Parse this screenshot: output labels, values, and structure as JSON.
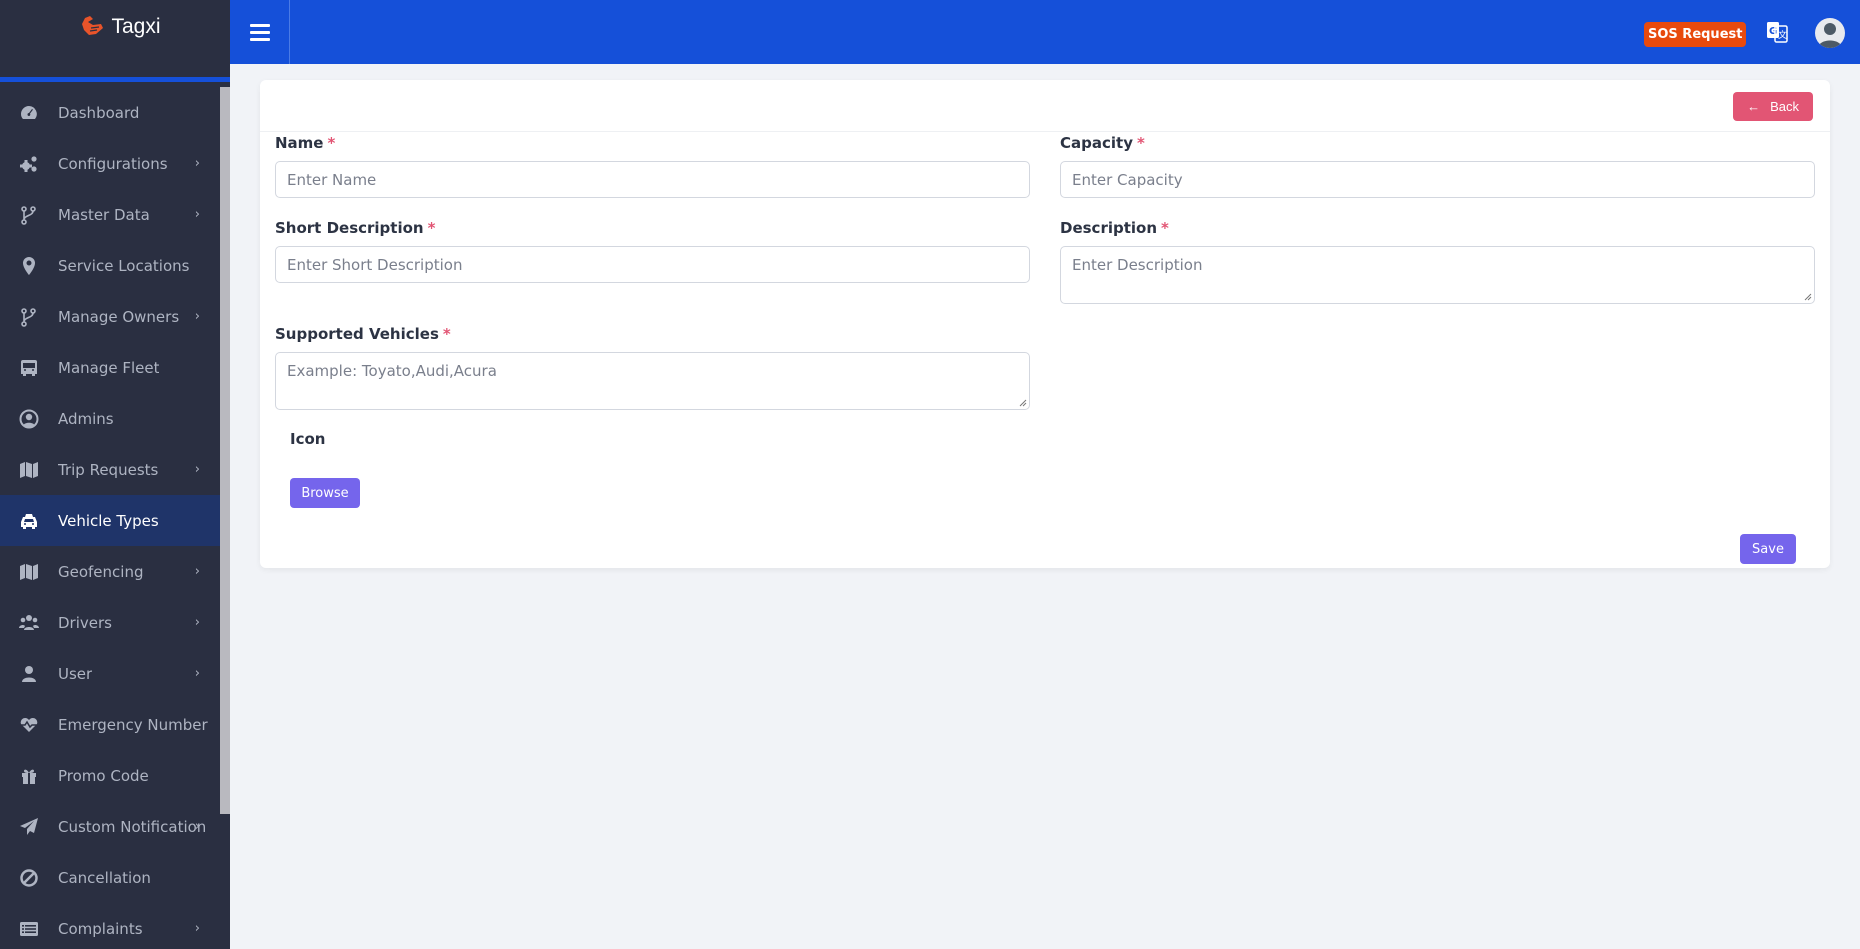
{
  "brand": {
    "name": "Tagxi",
    "logo_color": "#e8542a"
  },
  "header": {
    "sos_label": "SOS Request",
    "translate_icon": "translate-icon",
    "avatar_icon": "user-avatar-icon"
  },
  "sidebar": {
    "items": [
      {
        "label": "Dashboard",
        "icon": "dashboard-icon",
        "has_children": false,
        "active": false
      },
      {
        "label": "Configurations",
        "icon": "cogs-icon",
        "has_children": true,
        "active": false
      },
      {
        "label": "Master Data",
        "icon": "code-branch-icon",
        "has_children": true,
        "active": false
      },
      {
        "label": "Service Locations",
        "icon": "map-marker-icon",
        "has_children": false,
        "active": false
      },
      {
        "label": "Manage Owners",
        "icon": "code-branch-icon",
        "has_children": true,
        "active": false
      },
      {
        "label": "Manage Fleet",
        "icon": "bus-icon",
        "has_children": false,
        "active": false
      },
      {
        "label": "Admins",
        "icon": "user-circle-icon",
        "has_children": false,
        "active": false
      },
      {
        "label": "Trip Requests",
        "icon": "map-icon",
        "has_children": true,
        "active": false
      },
      {
        "label": "Vehicle Types",
        "icon": "taxi-icon",
        "has_children": false,
        "active": true
      },
      {
        "label": "Geofencing",
        "icon": "map-icon",
        "has_children": true,
        "active": false
      },
      {
        "label": "Drivers",
        "icon": "users-icon",
        "has_children": true,
        "active": false
      },
      {
        "label": "User",
        "icon": "user-icon",
        "has_children": true,
        "active": false
      },
      {
        "label": "Emergency Number",
        "icon": "heartbeat-icon",
        "has_children": false,
        "active": false
      },
      {
        "label": "Promo Code",
        "icon": "gift-icon",
        "has_children": false,
        "active": false
      },
      {
        "label": "Custom Notification",
        "icon": "paper-plane-icon",
        "has_children": true,
        "active": false
      },
      {
        "label": "Cancellation",
        "icon": "ban-icon",
        "has_children": false,
        "active": false
      },
      {
        "label": "Complaints",
        "icon": "list-alt-icon",
        "has_children": true,
        "active": false
      }
    ],
    "chevron": "›"
  },
  "form": {
    "back_label": "Back",
    "back_arrow": "←",
    "required_mark": "*",
    "name": {
      "label": "Name",
      "placeholder": "Enter Name",
      "value": ""
    },
    "capacity": {
      "label": "Capacity",
      "placeholder": "Enter Capacity",
      "value": ""
    },
    "short_description": {
      "label": "Short Description",
      "placeholder": "Enter Short Description",
      "value": ""
    },
    "description": {
      "label": "Description",
      "placeholder": "Enter Description",
      "value": ""
    },
    "supported_vehicles": {
      "label": "Supported Vehicles",
      "placeholder": "Example: Toyato,Audi,Acura",
      "value": ""
    },
    "icon": {
      "label": "Icon",
      "browse_label": "Browse"
    },
    "save_label": "Save"
  },
  "colors": {
    "primary": "#1550d9",
    "sidebar_bg": "#2a2f41",
    "sidebar_active": "#1f3469",
    "danger": "#e25574",
    "sos": "#e84a0d",
    "purple": "#7565ec"
  }
}
